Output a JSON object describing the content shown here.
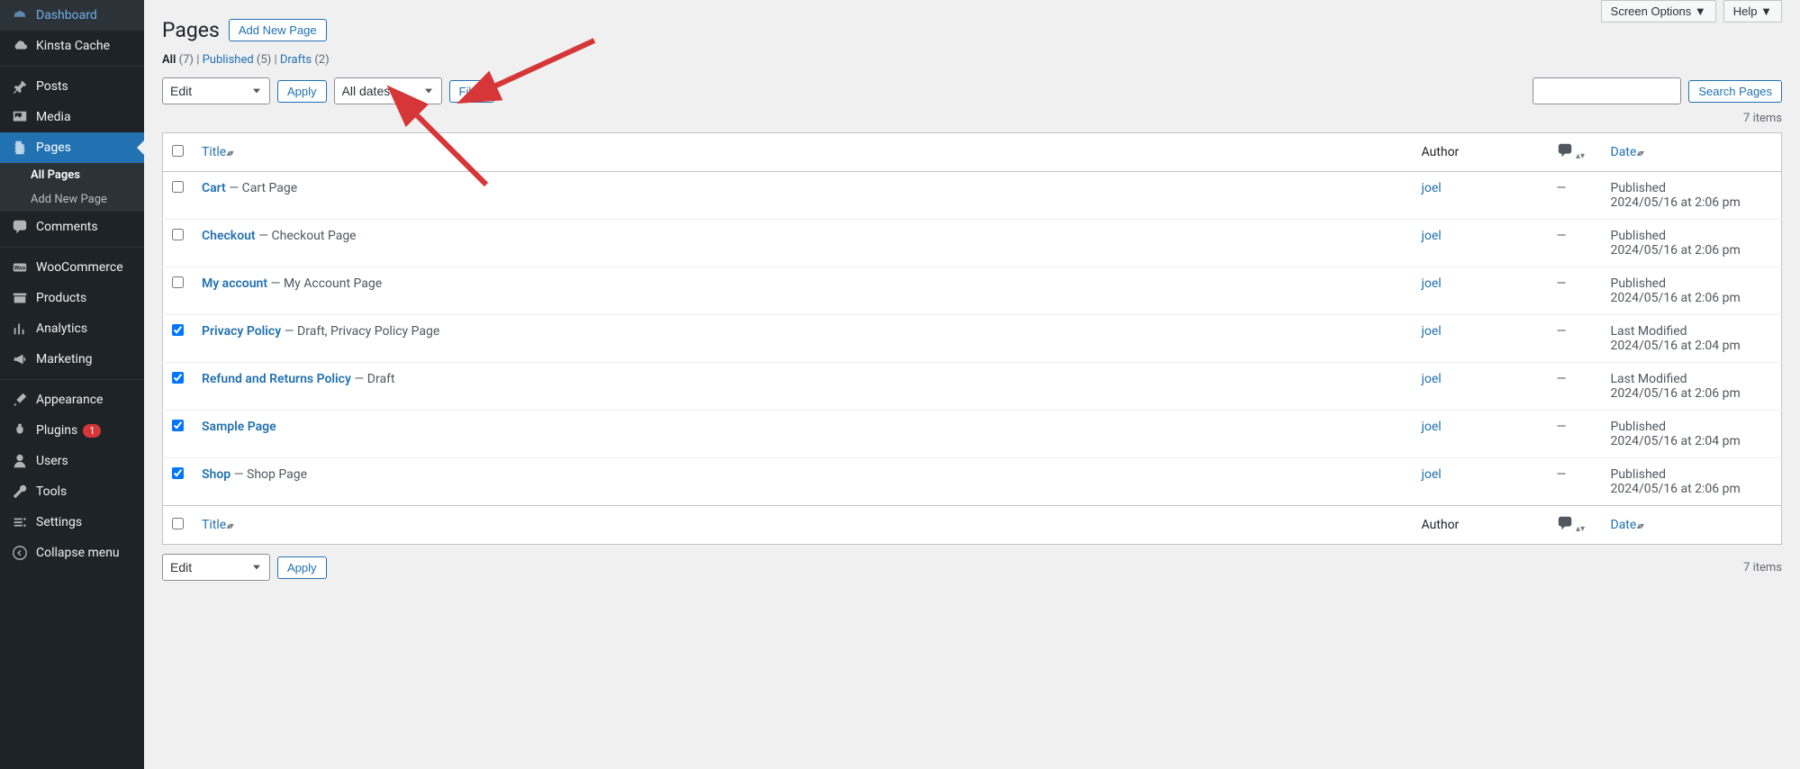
{
  "sidebar": {
    "items": [
      {
        "icon": "dashboard",
        "label": "Dashboard"
      },
      {
        "icon": "cloud",
        "label": "Kinsta Cache"
      },
      {
        "separator": true
      },
      {
        "icon": "pin",
        "label": "Posts"
      },
      {
        "icon": "media",
        "label": "Media"
      },
      {
        "icon": "page",
        "label": "Pages",
        "current": true,
        "submenu": [
          {
            "label": "All Pages",
            "current": true
          },
          {
            "label": "Add New Page"
          }
        ]
      },
      {
        "icon": "comment",
        "label": "Comments"
      },
      {
        "separator": true
      },
      {
        "icon": "woo",
        "label": "WooCommerce"
      },
      {
        "icon": "archive",
        "label": "Products"
      },
      {
        "icon": "chart",
        "label": "Analytics"
      },
      {
        "icon": "megaphone",
        "label": "Marketing"
      },
      {
        "separator": true
      },
      {
        "icon": "brush",
        "label": "Appearance"
      },
      {
        "icon": "plug",
        "label": "Plugins",
        "badge": "1"
      },
      {
        "icon": "user",
        "label": "Users"
      },
      {
        "icon": "wrench",
        "label": "Tools"
      },
      {
        "icon": "settings",
        "label": "Settings"
      },
      {
        "icon": "collapse",
        "label": "Collapse menu",
        "collapse": true
      }
    ]
  },
  "header": {
    "title": "Pages",
    "add_new": "Add New Page",
    "screen_options": "Screen Options",
    "help": "Help"
  },
  "filters": {
    "views": [
      {
        "label": "All",
        "count": "(7)",
        "current": true
      },
      {
        "label": "Published",
        "count": "(5)"
      },
      {
        "label": "Drafts",
        "count": "(2)"
      }
    ],
    "bulk_action_value": "Edit",
    "apply": "Apply",
    "date_filter": "All dates",
    "filter": "Filter",
    "search": "Search Pages",
    "items_count": "7 items"
  },
  "table": {
    "columns": {
      "title": "Title",
      "author": "Author",
      "date": "Date"
    },
    "rows": [
      {
        "checked": false,
        "title": "Cart",
        "suffix": " — Cart Page",
        "author": "joel",
        "comments": "—",
        "status": "Published",
        "date": "2024/05/16 at 2:06 pm"
      },
      {
        "checked": false,
        "title": "Checkout",
        "suffix": " — Checkout Page",
        "author": "joel",
        "comments": "—",
        "status": "Published",
        "date": "2024/05/16 at 2:06 pm"
      },
      {
        "checked": false,
        "title": "My account",
        "suffix": " — My Account Page",
        "author": "joel",
        "comments": "—",
        "status": "Published",
        "date": "2024/05/16 at 2:06 pm"
      },
      {
        "checked": true,
        "title": "Privacy Policy",
        "suffix": " — Draft, Privacy Policy Page",
        "author": "joel",
        "comments": "—",
        "status": "Last Modified",
        "date": "2024/05/16 at 2:04 pm"
      },
      {
        "checked": true,
        "title": "Refund and Returns Policy",
        "suffix": " — Draft",
        "author": "joel",
        "comments": "—",
        "status": "Last Modified",
        "date": "2024/05/16 at 2:06 pm"
      },
      {
        "checked": true,
        "title": "Sample Page",
        "suffix": "",
        "author": "joel",
        "comments": "—",
        "status": "Published",
        "date": "2024/05/16 at 2:04 pm"
      },
      {
        "checked": true,
        "title": "Shop",
        "suffix": " — Shop Page",
        "author": "joel",
        "comments": "—",
        "status": "Published",
        "date": "2024/05/16 at 2:06 pm"
      }
    ]
  }
}
